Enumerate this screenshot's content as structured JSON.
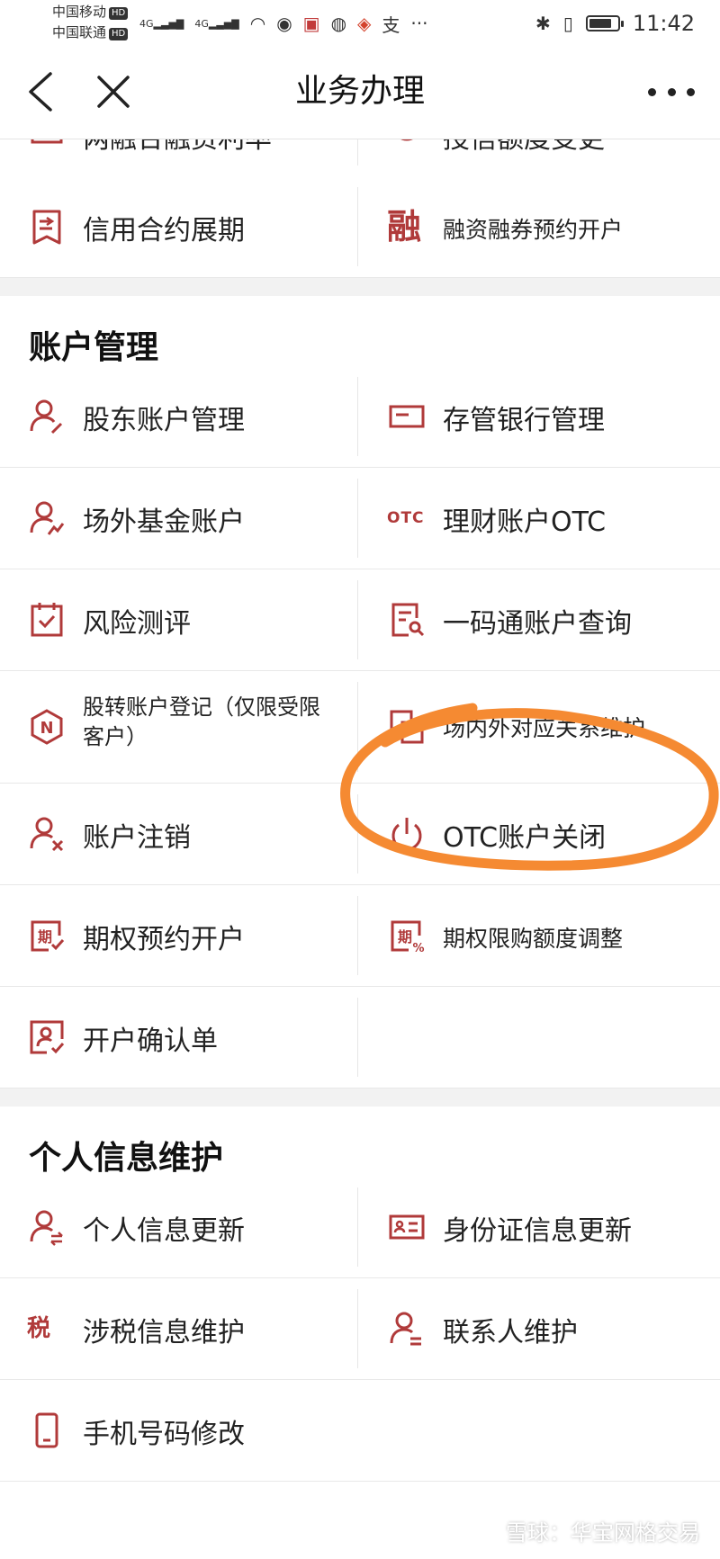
{
  "status_bar": {
    "carrier_1": "中国移动",
    "carrier_2": "中国联通",
    "hd": "HD",
    "network_1": "4G",
    "network_2": "4G",
    "time": "11:42",
    "app_icons": [
      "wifi-icon",
      "browser-icon",
      "book-app-icon",
      "wechat-icon",
      "weibo-icon",
      "alipay-icon",
      "more-dots-icon"
    ],
    "battery_level": 0.8
  },
  "nav": {
    "title": "业务办理",
    "back_icon": "chevron-left-icon",
    "close_icon": "close-icon",
    "more_icon": "more-horizontal-icon"
  },
  "top_section": {
    "partial_row": {
      "left": "两融合融资利率",
      "right": "授信额度变更"
    },
    "row": {
      "left": "信用合约展期",
      "right": "融资融券预约开户",
      "right_glyph": "融"
    }
  },
  "account_management": {
    "title": "账户管理",
    "items": [
      {
        "label": "股东账户管理",
        "icon": "user-edit-icon"
      },
      {
        "label": "存管银行管理",
        "icon": "bank-card-icon"
      },
      {
        "label": "场外基金账户",
        "icon": "user-trend-icon"
      },
      {
        "label": "理财账户OTC",
        "icon": "otc-icon",
        "glyph": "OTC"
      },
      {
        "label": "风险测评",
        "icon": "checklist-icon"
      },
      {
        "label": "一码通账户查询",
        "icon": "document-search-icon"
      },
      {
        "label": "股转账户登记（仅限受限客户）",
        "icon": "hexagon-n-icon"
      },
      {
        "label": "场内外对应关系维护",
        "icon": "linked-squares-icon"
      },
      {
        "label": "账户注销",
        "icon": "user-remove-icon"
      },
      {
        "label": "OTC账户关闭",
        "icon": "power-icon"
      },
      {
        "label": "期权预约开户",
        "icon": "option-calendar-icon",
        "glyph": "期"
      },
      {
        "label": "期权限购额度调整",
        "icon": "option-percent-icon",
        "glyph": "期"
      },
      {
        "label": "开户确认单",
        "icon": "user-check-icon"
      }
    ]
  },
  "personal_info": {
    "title": "个人信息维护",
    "items": [
      {
        "label": "个人信息更新",
        "icon": "user-sync-icon"
      },
      {
        "label": "身份证信息更新",
        "icon": "id-card-icon"
      },
      {
        "label": "涉税信息维护",
        "icon": "tax-icon",
        "glyph": "税"
      },
      {
        "label": "联系人维护",
        "icon": "contact-icon"
      },
      {
        "label": "手机号码修改",
        "icon": "phone-icon"
      }
    ]
  },
  "watermark": "雪球：华宝网格交易",
  "annotation_color": "#f58a32",
  "accent_color": "#b03a3a"
}
